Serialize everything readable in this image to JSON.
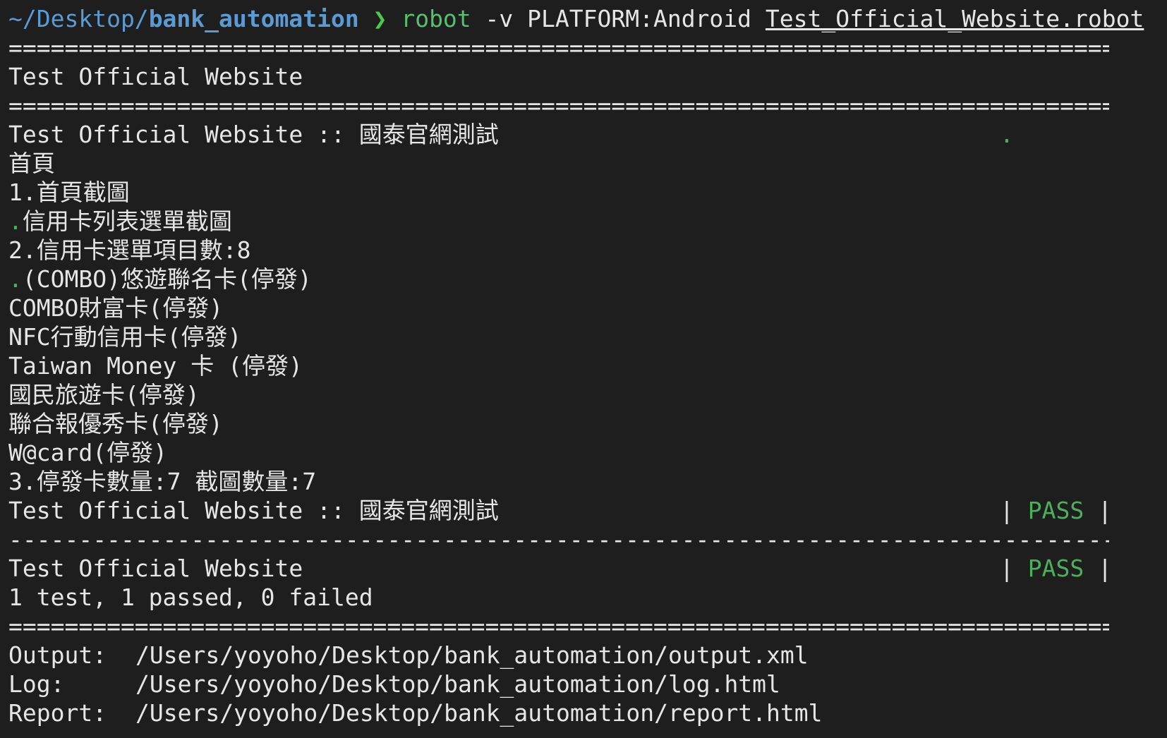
{
  "prompt": {
    "cwd_prefix": "~/Desktop/",
    "cwd_base": "bank_automation",
    "symbol": "❯",
    "command": "robot",
    "args": "-v PLATFORM:Android",
    "file": "Test_Official_Website.robot"
  },
  "separators": {
    "double": "====================================================================================================",
    "single": "----------------------------------------------------------------------------------------------------"
  },
  "suite": {
    "name": "Test Official Website"
  },
  "test_header": {
    "title": "Test Official Website :: 國泰官網測試",
    "progress_dot": "."
  },
  "log_lines": [
    {
      "dot": "",
      "text": "首頁"
    },
    {
      "dot": "",
      "text": "1.首頁截圖"
    },
    {
      "dot": ".",
      "text": "信用卡列表選單截圖"
    },
    {
      "dot": "",
      "text": "2.信用卡選單項目數:8"
    },
    {
      "dot": ".",
      "text": "(COMBO)悠遊聯名卡(停發)"
    },
    {
      "dot": "",
      "text": "COMBO財富卡(停發)"
    },
    {
      "dot": "",
      "text": "NFC行動信用卡(停發)"
    },
    {
      "dot": "",
      "text": "Taiwan Money 卡 (停發)"
    },
    {
      "dot": "",
      "text": "國民旅遊卡(停發)"
    },
    {
      "dot": "",
      "text": "聯合報優秀卡(停發)"
    },
    {
      "dot": "",
      "text": "W@card(停發)"
    },
    {
      "dot": "",
      "text": "3.停發卡數量:7 截圖數量:7"
    }
  ],
  "test_result": {
    "title": "Test Official Website :: 國泰官網測試",
    "pipe": "|",
    "status": "PASS"
  },
  "suite_result": {
    "title": "Test Official Website",
    "pipe": "|",
    "status": "PASS",
    "summary": "1 test, 1 passed, 0 failed"
  },
  "outputs": [
    {
      "label": "Output:",
      "path": "/Users/yoyoho/Desktop/bank_automation/output.xml"
    },
    {
      "label": "Log:",
      "path": "/Users/yoyoho/Desktop/bank_automation/log.html"
    },
    {
      "label": "Report:",
      "path": "/Users/yoyoho/Desktop/bank_automation/report.html"
    }
  ],
  "colors": {
    "background": "#1e1e1e",
    "path": "#5a9bd5",
    "prompt_symbol": "#4ec94e",
    "command": "#56c06d",
    "pass": "#4cb05a"
  }
}
